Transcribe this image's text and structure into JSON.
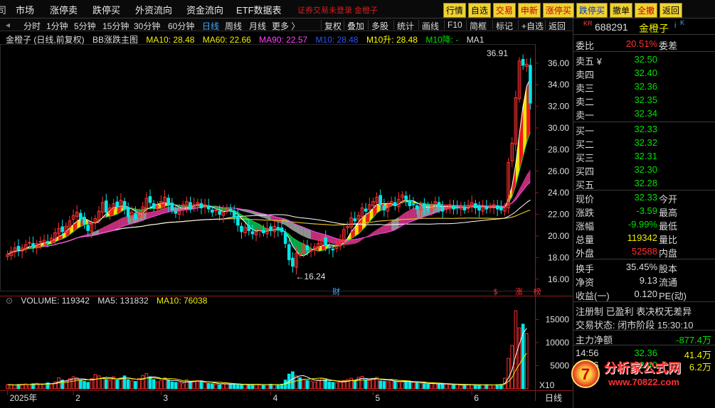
{
  "menubar": {
    "items": [
      "市场",
      "涨停卖",
      "跌停买",
      "外资流向",
      "资金流向",
      "ETF数据表"
    ],
    "login_note": "证券交易未登录  金橙子",
    "buttons": [
      {
        "label": "行情",
        "color": "normal"
      },
      {
        "label": "自选",
        "color": "normal"
      },
      {
        "label": "交易",
        "color": "red"
      },
      {
        "label": "申新",
        "color": "red"
      },
      {
        "label": "涨停买",
        "color": "red"
      },
      {
        "label": "跌停买",
        "color": "blue"
      },
      {
        "label": "撤单",
        "color": "normal"
      },
      {
        "label": "全撤",
        "color": "red"
      },
      {
        "label": "返回",
        "color": "normal"
      }
    ]
  },
  "periodbar": {
    "periods": [
      "分时",
      "1分钟",
      "5分钟",
      "15分钟",
      "30分钟",
      "60分钟",
      "日线",
      "周线",
      "月线",
      "更多 〉"
    ],
    "selected": "日线",
    "tools": [
      "复权",
      "叠加",
      "多股",
      "统计",
      "画线",
      "F10",
      "简框",
      "标记",
      "+自选",
      "返回"
    ]
  },
  "legend": {
    "stock": "金橙子 (日线,前复权)",
    "indicator": "BB涨跌主图",
    "ma10": "MA10: 28.48",
    "ma60": "MA60: 22.66",
    "ma90": "MA90: 22.57",
    "m10_blue": "M10: 28.48",
    "m10_up": "M10升: 28.48",
    "m10_down": "M10降: -",
    "ma1": "MA1",
    "colors": {
      "ma10": "#ffffff",
      "ma60": "#f0f000",
      "ma90": "#ff40ff",
      "m10": "#2040ff",
      "up": "#ffff00",
      "down": "#00ff00"
    }
  },
  "volume_legend": {
    "volume": "VOLUME: 119342",
    "ma5": "MA5: 131832",
    "ma10": "MA10: 76038"
  },
  "chart_data": {
    "type": "candlestick",
    "price_ylim": [
      15.0,
      37.5
    ],
    "price_ticks": [
      "36.00",
      "34.00",
      "32.00",
      "30.00",
      "28.00",
      "26.00",
      "24.00",
      "22.00",
      "20.00",
      "18.00",
      "16.00"
    ],
    "volume_ticks": [
      "15000",
      "10000",
      "5000"
    ],
    "volume_unit_label": "X10",
    "high_label": "36.91",
    "low_label": "16.24",
    "x_labels": [
      "2025年",
      "2",
      "3",
      "4",
      "5",
      "6"
    ],
    "x_label_index": [
      0,
      18,
      42,
      72,
      100,
      127
    ],
    "markers": [
      {
        "text": "财",
        "index": 90
      },
      {
        "text": "$",
        "index": 134
      },
      {
        "text": "涨",
        "index": 140
      },
      {
        "text": "榜",
        "index": 145
      }
    ],
    "corner_label": "日线",
    "close": [
      18.3,
      18.6,
      18.9,
      18.7,
      18.9,
      19.2,
      19.4,
      19.0,
      19.3,
      19.5,
      19.6,
      19.4,
      19.8,
      20.3,
      20.7,
      20.4,
      20.9,
      21.4,
      21.9,
      22.2,
      21.6,
      21.1,
      20.5,
      21.1,
      21.6,
      22.3,
      23.1,
      22.2,
      22.6,
      23.0,
      22.7,
      23.3,
      22.5,
      21.8,
      22.2,
      21.6,
      22.2,
      22.7,
      23.5,
      23.1,
      22.6,
      22.8,
      23.2,
      23.6,
      22.9,
      22.4,
      22.1,
      22.3,
      22.9,
      23.2,
      22.5,
      22.9,
      23.1,
      22.6,
      22.9,
      22.5,
      22.2,
      22.4,
      22.0,
      22.2,
      22.6,
      22.4,
      21.7,
      21.0,
      20.4,
      20.8,
      20.5,
      20.2,
      20.4,
      20.6,
      20.3,
      20.7,
      20.5,
      20.9,
      20.6,
      20.4,
      19.3,
      17.8,
      17.2,
      18.4,
      18.3,
      19.2,
      18.7,
      18.7,
      19.0,
      19.3,
      19.7,
      19.1,
      18.9,
      18.7,
      19.2,
      19.5,
      20.6,
      20.9,
      21.7,
      21.4,
      21.9,
      22.6,
      22.3,
      22.9,
      23.2,
      23.6,
      22.9,
      22.4,
      22.9,
      23.2,
      22.8,
      23.4,
      23.8,
      23.4,
      22.8,
      22.9,
      22.5,
      22.8,
      22.6,
      22.4,
      22.9,
      23.2,
      22.7,
      22.3,
      22.6,
      22.9,
      22.5,
      22.6,
      22.8,
      22.4,
      22.8,
      23.1,
      22.6,
      22.4,
      22.8,
      22.5,
      22.7,
      22.9,
      22.5,
      22.4,
      22.7,
      26.8,
      28.6,
      32.8,
      36.2,
      35.8,
      35.9,
      32.3
    ],
    "volume": [
      900,
      850,
      800,
      950,
      1000,
      1050,
      900,
      1100,
      1200,
      1000,
      1050,
      1300,
      1100,
      1500,
      2400,
      1900,
      1700,
      2200,
      2600,
      2400,
      1900,
      1600,
      1400,
      2200,
      3100,
      2800,
      2300,
      2000,
      1800,
      2600,
      1900,
      2400,
      2800,
      2000,
      1700,
      1600,
      2200,
      2900,
      3300,
      2600,
      2000,
      1500,
      1900,
      2400,
      1800,
      1500,
      1400,
      1300,
      1200,
      2000,
      1600,
      1700,
      1800,
      1500,
      1400,
      1200,
      1100,
      1000,
      900,
      1200,
      1100,
      1000,
      950,
      900,
      850,
      1000,
      900,
      950,
      1000,
      850,
      800,
      900,
      1000,
      950,
      900,
      1000,
      1900,
      3200,
      3700,
      2800,
      2400,
      2100,
      1800,
      1700,
      1500,
      1900,
      2200,
      2000,
      1500,
      1400,
      1300,
      1500,
      1800,
      2000,
      2300,
      1700,
      2500,
      2700,
      2000,
      1800,
      2200,
      2500,
      1700,
      1600,
      1500,
      1900,
      1700,
      1400,
      1500,
      1600,
      1500,
      1400,
      1300,
      1200,
      1100,
      1000,
      1200,
      1100,
      1000,
      1100,
      1000,
      900,
      850,
      900,
      800,
      850,
      900,
      900,
      850,
      800,
      850,
      900,
      800,
      850,
      900,
      950,
      2300,
      6600,
      9400,
      16900,
      13200,
      14000,
      11934
    ]
  },
  "quote": {
    "code": "688291",
    "name": "金橙子",
    "wb_label": "委比",
    "wb_value": "20.51%",
    "wc_label": "委差",
    "sells": [
      {
        "label": "卖五 ¥",
        "price": "32.50"
      },
      {
        "label": "卖四",
        "price": "32.40"
      },
      {
        "label": "卖三",
        "price": "32.36"
      },
      {
        "label": "卖二",
        "price": "32.35"
      },
      {
        "label": "卖一",
        "price": "32.34"
      }
    ],
    "buys": [
      {
        "label": "买一",
        "price": "32.33"
      },
      {
        "label": "买二",
        "price": "32.32"
      },
      {
        "label": "买三",
        "price": "32.31"
      },
      {
        "label": "买四",
        "price": "32.30"
      },
      {
        "label": "买五",
        "price": "32.28"
      }
    ],
    "stats": [
      {
        "label": "现价",
        "value": "32.33",
        "label2": "今开",
        "color": "#00e000"
      },
      {
        "label": "涨跌",
        "value": "-3.59",
        "label2": "最高",
        "color": "#00e000"
      },
      {
        "label": "涨幅",
        "value": "-9.99%",
        "label2": "最低",
        "color": "#00e000"
      },
      {
        "label": "总量",
        "value": "119342",
        "label2": "量比",
        "color": "#f0f000"
      },
      {
        "label": "外盘",
        "value": "52588",
        "label2": "内盘",
        "color": "#ff3030"
      }
    ],
    "stats2": [
      {
        "label": "换手",
        "value": "35.45%",
        "label2": "股本"
      },
      {
        "label": "净资",
        "value": "9.13",
        "label2": "流通"
      },
      {
        "label": "收益(一)",
        "value": "0.120",
        "label2": "PE(动)"
      }
    ],
    "tags": "注册制 已盈利 表决权无差异",
    "status": "交易状态: 闭市阶段 15:30:10",
    "flow_label": "主力净额",
    "flow_value": "-877.4万",
    "ticks": [
      {
        "time": "14:56",
        "price": "32.36",
        "vol": "41.4万"
      },
      {
        "time": "14:56",
        "price": "32.40",
        "vol": "6.2万"
      }
    ]
  },
  "watermark": {
    "line1": "分析家公式网",
    "line2": "www.70822.com",
    "badge": "7"
  }
}
